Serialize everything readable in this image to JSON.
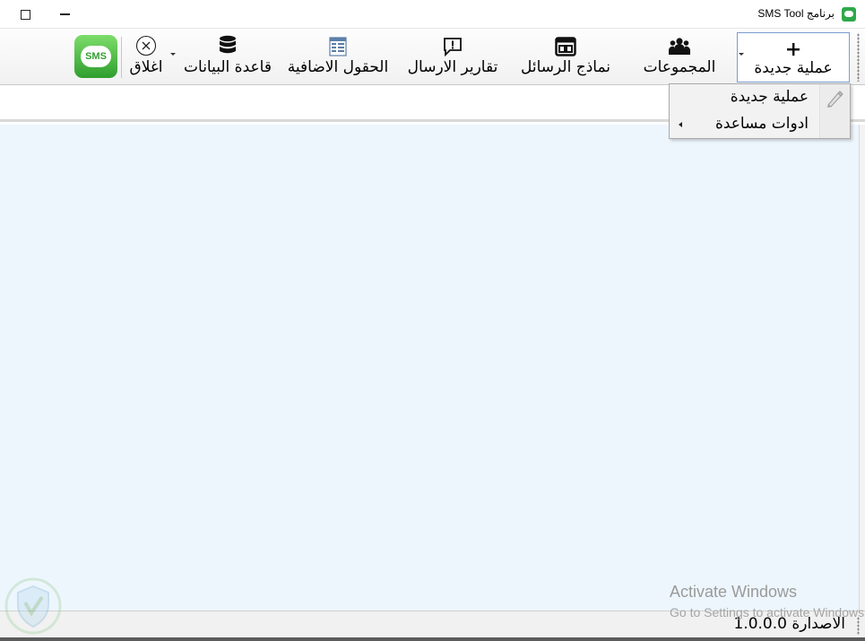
{
  "window": {
    "title": "برنامج SMS Tool",
    "controls": {
      "maximize": "maximize",
      "minimize": "minimize"
    }
  },
  "ribbon": {
    "buttons": [
      {
        "id": "new-operation",
        "label": "عملية جديدة",
        "icon": "plus-icon"
      },
      {
        "id": "groups",
        "label": "المجموعات",
        "icon": "users-icon"
      },
      {
        "id": "templates",
        "label": "نماذج الرسائل",
        "icon": "layout-icon"
      },
      {
        "id": "reports",
        "label": "تقارير الارسال",
        "icon": "alert-bubble-icon"
      },
      {
        "id": "extra-fields",
        "label": "الحقول الاضافية",
        "icon": "table-icon"
      },
      {
        "id": "database",
        "label": "قاعدة البيانات",
        "icon": "database-icon"
      },
      {
        "id": "close",
        "label": "اغلاق",
        "icon": "close-circle-icon"
      }
    ],
    "sms_logo": "SMS"
  },
  "dropdown_menu": {
    "items": [
      {
        "label": "عملية جديدة",
        "icon": "pen-icon"
      },
      {
        "label": "ادوات مساعدة",
        "icon": "submenu-arrow-icon"
      }
    ]
  },
  "statusbar": {
    "version": "الاصدارة 1.0.0.0"
  },
  "activation_watermark": {
    "title": "Activate Windows",
    "subtitle": "Go to Settings to activate Windows."
  },
  "colors": {
    "workspace": "#eef6fd",
    "accent_border": "#7a9cd0",
    "sms_green": "#2f9e2f"
  }
}
